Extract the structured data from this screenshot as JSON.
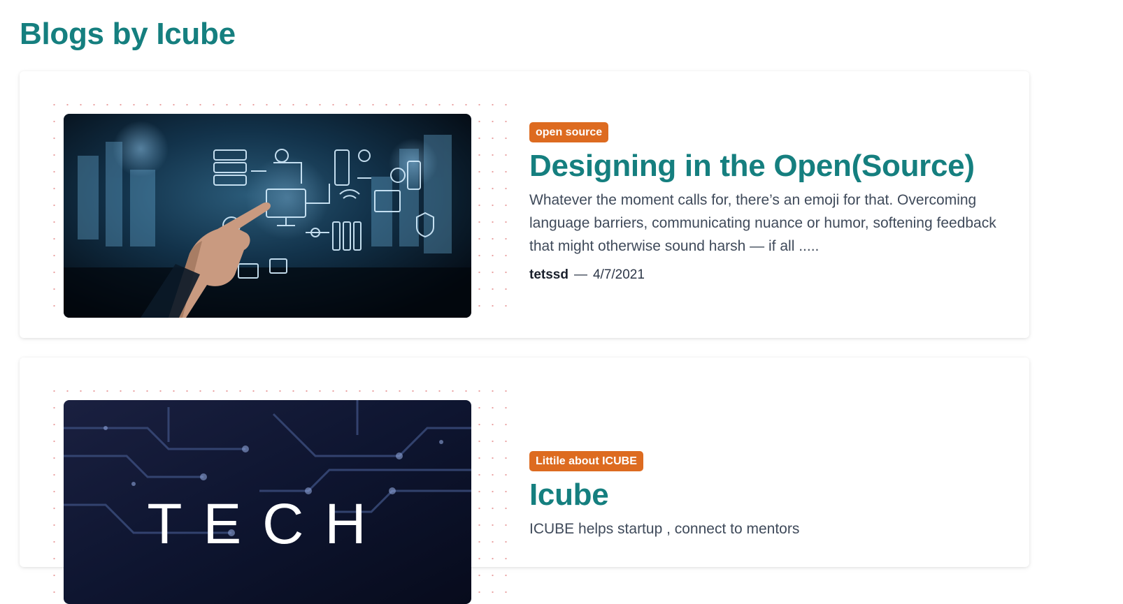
{
  "page": {
    "title": "Blogs by Icube"
  },
  "posts": [
    {
      "tag": "open source",
      "title": "Designing in the Open(Source)",
      "excerpt": "Whatever the moment calls for, there’s an emoji for that. Overcoming language barriers, communicating nuance or humor, softening feedback that might otherwise sound harsh — if all .....",
      "author": "tetssd",
      "separator": "—",
      "date": "4/7/2021",
      "image_icon": "tech-network-image"
    },
    {
      "tag": "Littile about ICUBE",
      "title": "Icube",
      "excerpt": "ICUBE helps startup , connect to mentors",
      "image_text": "TECH",
      "image_icon": "circuit-board-image"
    }
  ],
  "colors": {
    "accent": "#157f7f",
    "tag": "#dd6b20",
    "text": "#3f4a5a"
  }
}
